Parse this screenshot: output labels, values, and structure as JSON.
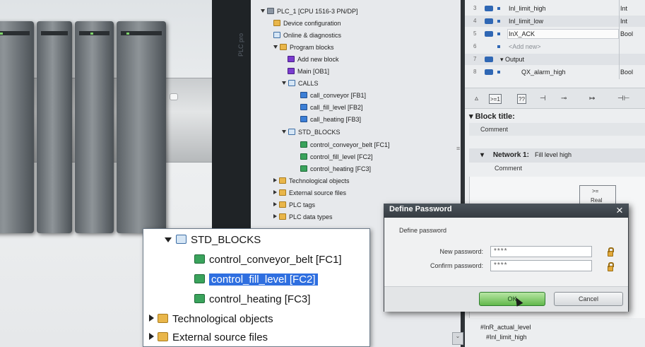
{
  "side_strip_label": "PLC pro",
  "project_tree": {
    "items": [
      {
        "label": "PLC_1 [CPU 1516-3 PN/DP]"
      },
      {
        "label": "Device configuration"
      },
      {
        "label": "Online & diagnostics"
      },
      {
        "label": "Program blocks"
      },
      {
        "label": "Add new block"
      },
      {
        "label": "Main [OB1]"
      },
      {
        "label": "CALLS"
      },
      {
        "label": "call_conveyor [FB1]"
      },
      {
        "label": "call_fill_level [FB2]"
      },
      {
        "label": "call_heating [FB3]"
      },
      {
        "label": "STD_BLOCKS"
      },
      {
        "label": "control_conveyor_belt [FC1]"
      },
      {
        "label": "control_fill_level [FC2]"
      },
      {
        "label": "control_heating [FC3]"
      },
      {
        "label": "Technological objects"
      },
      {
        "label": "External source files"
      },
      {
        "label": "PLC tags"
      },
      {
        "label": "PLC data types"
      }
    ]
  },
  "interface_table": {
    "rows": [
      {
        "num": "3",
        "name": "Inl_limit_high",
        "type": "Int"
      },
      {
        "num": "4",
        "name": "Inl_limit_low",
        "type": "Int"
      },
      {
        "num": "5",
        "name": "InX_ACK",
        "type": "Bool"
      },
      {
        "num": "6",
        "name": "<Add new>",
        "type": ""
      },
      {
        "num": "7",
        "name": "Output",
        "type": ""
      },
      {
        "num": "8",
        "name": "QX_alarm_high",
        "type": "Bool"
      }
    ]
  },
  "ladder_toolbar": {
    "items": [
      ">=1",
      "??",
      "⊣",
      "⊸",
      "↦",
      "⊣⊢"
    ]
  },
  "editor": {
    "block_title": "Block title:",
    "block_comment": "Comment",
    "network_label": "Network 1:",
    "network_title": "Fill level high",
    "network_comment": "Comment",
    "box_op": ">=",
    "box_type": "Real",
    "refs": [
      "#InR_actual_level",
      "#Inl_limit_high"
    ]
  },
  "dialog": {
    "title": "Define Password",
    "subtitle": "Define password",
    "new_password_label": "New password:",
    "new_password_value": "****",
    "confirm_password_label": "Confirm password:",
    "confirm_password_value": "****",
    "ok_label": "OK",
    "cancel_label": "Cancel"
  },
  "zoom_inset": {
    "items": [
      {
        "label": "STD_BLOCKS"
      },
      {
        "label": "control_conveyor_belt [FC1]"
      },
      {
        "label": "control_fill_level [FC2]"
      },
      {
        "label": "control_heating [FC3]"
      },
      {
        "label": "Technological objects"
      },
      {
        "label": "External source files"
      }
    ]
  }
}
